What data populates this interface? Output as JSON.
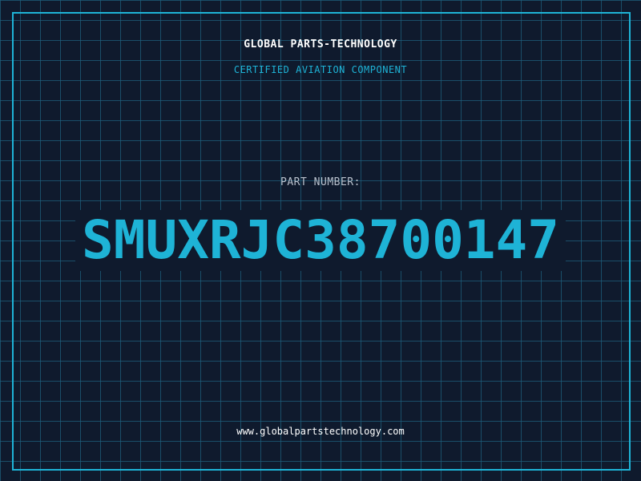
{
  "header": {
    "company": "GLOBAL PARTS-TECHNOLOGY",
    "tagline": "CERTIFIED AVIATION COMPONENT"
  },
  "part": {
    "label": "PART NUMBER:",
    "number": "SMUXRJC38700147"
  },
  "footer": {
    "website": "www.globalpartstechnology.com"
  },
  "colors": {
    "background": "#0f1a2d",
    "grid": "#1e5f7d",
    "accent": "#1eb3d6",
    "label": "#b8c0cc",
    "text": "#ffffff"
  }
}
